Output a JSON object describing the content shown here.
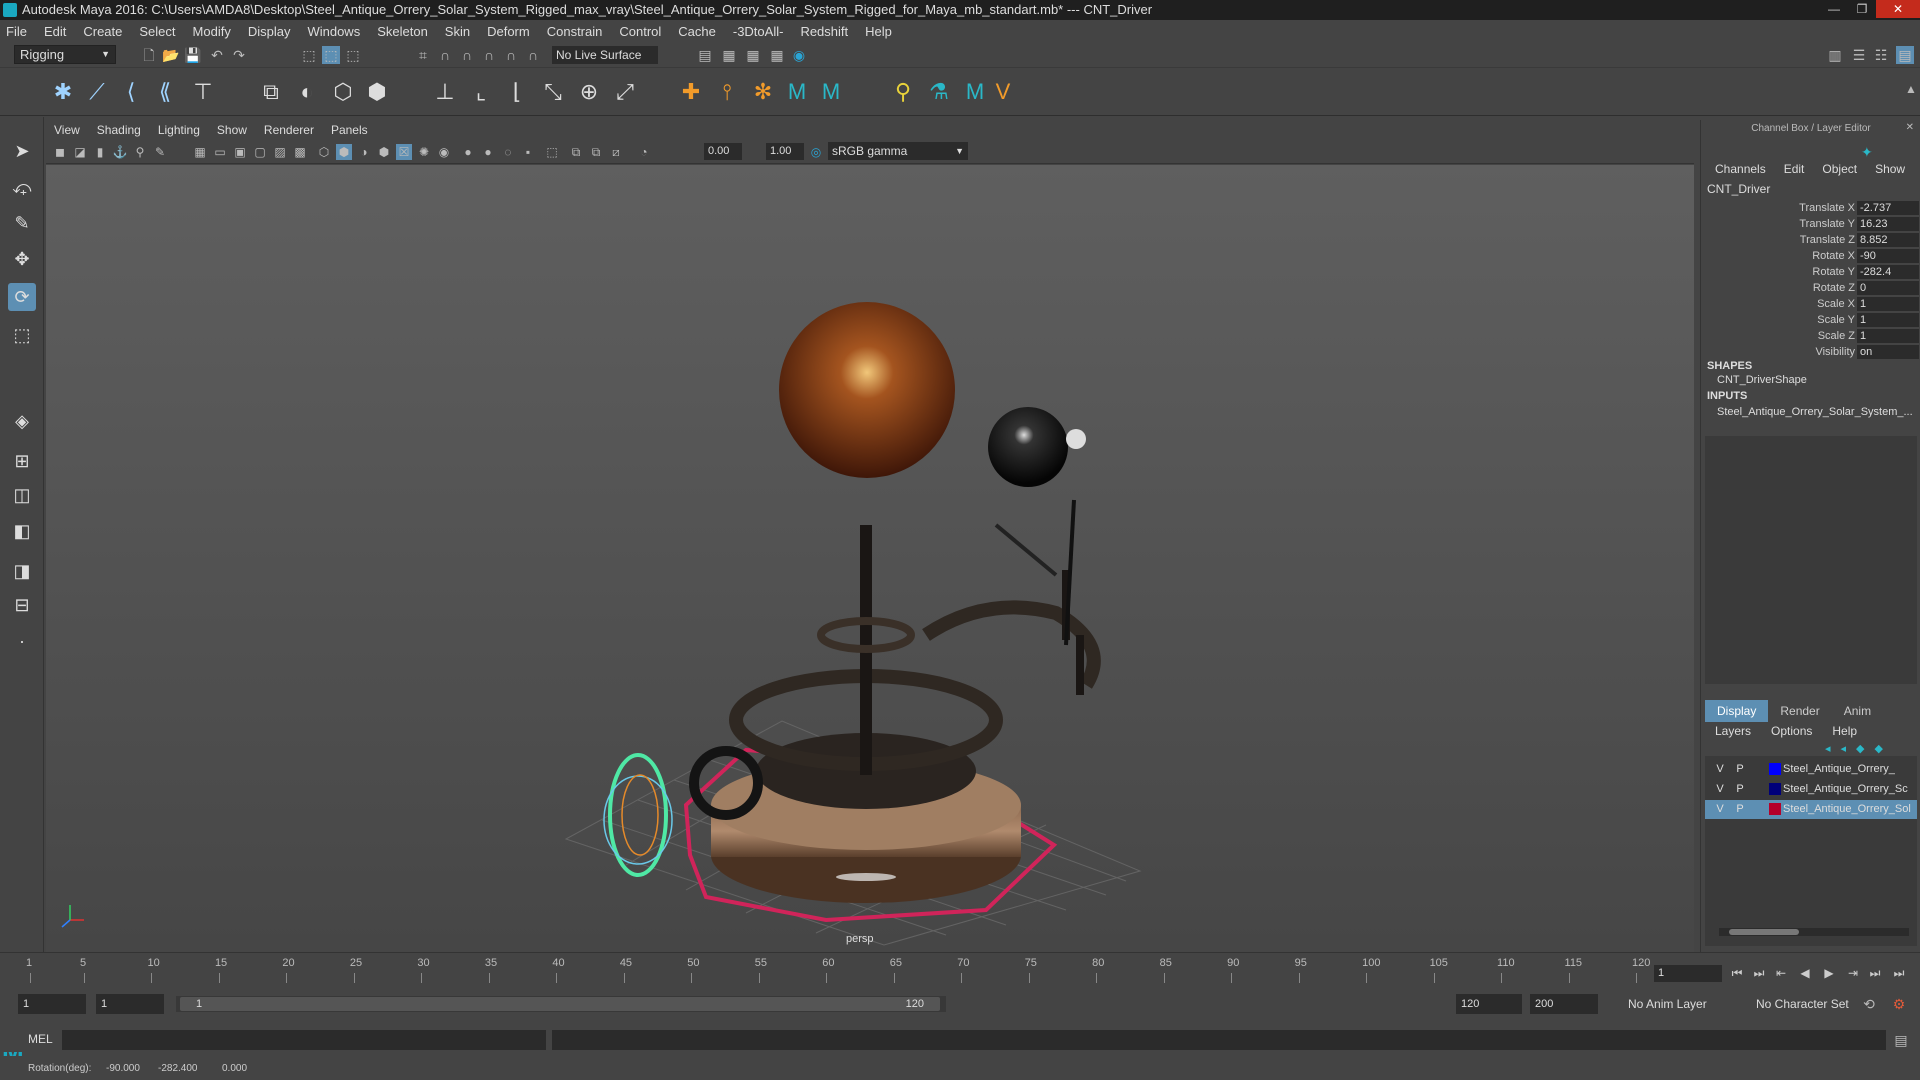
{
  "window": {
    "title": "Autodesk Maya 2016: C:\\Users\\AMDA8\\Desktop\\Steel_Antique_Orrery_Solar_System_Rigged_max_vray\\Steel_Antique_Orrery_Solar_System_Rigged_for_Maya_mb_standart.mb*   ---   CNT_Driver"
  },
  "menu": [
    "File",
    "Edit",
    "Create",
    "Select",
    "Modify",
    "Display",
    "Windows",
    "Skeleton",
    "Skin",
    "Deform",
    "Constrain",
    "Control",
    "Cache",
    "-3DtoAll-",
    "Redshift",
    "Help"
  ],
  "status": {
    "mode": "Rigging",
    "live_surface": "No Live Surface"
  },
  "panel_menu": [
    "View",
    "Shading",
    "Lighting",
    "Show",
    "Renderer",
    "Panels"
  ],
  "panel_toolbar": {
    "near": "0.00",
    "far": "1.00",
    "gamma": "sRGB gamma"
  },
  "viewport": {
    "camera_label": "persp"
  },
  "channel_box": {
    "title": "Channel Box / Layer Editor",
    "menu": [
      "Channels",
      "Edit",
      "Object",
      "Show"
    ],
    "object": "CNT_Driver",
    "attributes": [
      {
        "label": "Translate X",
        "value": "-2.737"
      },
      {
        "label": "Translate Y",
        "value": "16.23"
      },
      {
        "label": "Translate Z",
        "value": "8.852"
      },
      {
        "label": "Rotate X",
        "value": "-90"
      },
      {
        "label": "Rotate Y",
        "value": "-282.4"
      },
      {
        "label": "Rotate Z",
        "value": "0"
      },
      {
        "label": "Scale X",
        "value": "1"
      },
      {
        "label": "Scale Y",
        "value": "1"
      },
      {
        "label": "Scale Z",
        "value": "1"
      },
      {
        "label": "Visibility",
        "value": "on"
      }
    ],
    "shapes_header": "SHAPES",
    "shape": "CNT_DriverShape",
    "inputs_header": "INPUTS",
    "input": "Steel_Antique_Orrery_Solar_System_..."
  },
  "layer_editor": {
    "tabs": [
      "Display",
      "Render",
      "Anim"
    ],
    "menu": [
      "Layers",
      "Options",
      "Help"
    ],
    "layers": [
      {
        "v": "V",
        "p": "P",
        "color": "#0000ff",
        "name": "Steel_Antique_Orrery_"
      },
      {
        "v": "V",
        "p": "P",
        "color": "#00007a",
        "name": "Steel_Antique_Orrery_Sc"
      },
      {
        "v": "V",
        "p": "P",
        "color": "#b5002a",
        "name": "Steel_Antique_Orrery_Sol"
      }
    ]
  },
  "timeline": {
    "ticks": [
      "1",
      "5",
      "10",
      "15",
      "20",
      "25",
      "30",
      "35",
      "40",
      "45",
      "50",
      "55",
      "60",
      "65",
      "70",
      "75",
      "80",
      "85",
      "90",
      "95",
      "100",
      "105",
      "110",
      "115",
      "120"
    ],
    "current_frame": "1"
  },
  "range": {
    "start": "1",
    "playback_start": "1",
    "slider_low": "1",
    "slider_high": "120",
    "playback_end": "120",
    "end": "200",
    "anim_layer": "No Anim Layer",
    "character_set": "No Character Set"
  },
  "cmdline": {
    "label": "MEL"
  },
  "helpline": {
    "label": "Rotation(deg):",
    "x": "-90.000",
    "y": "-282.400",
    "z": "0.000"
  }
}
